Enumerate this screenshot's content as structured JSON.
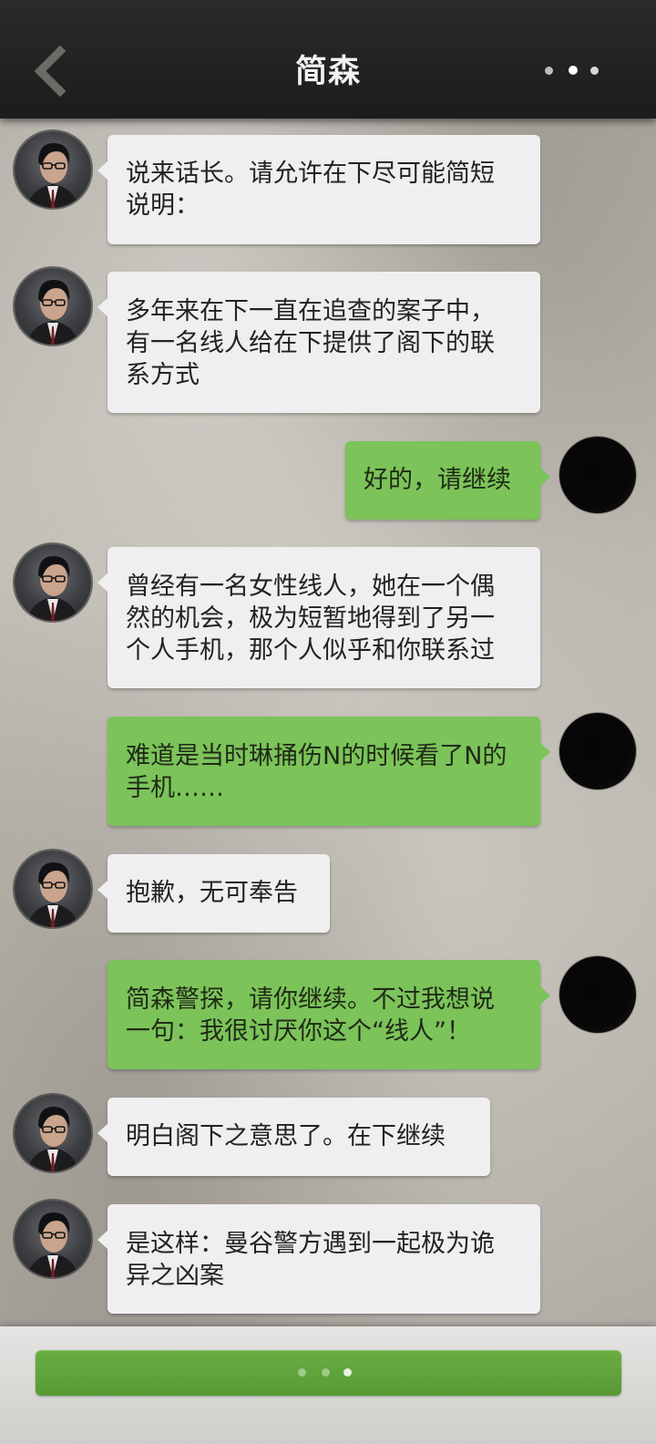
{
  "header": {
    "title": "简森",
    "back_icon": "chevron-left-icon",
    "more_icon": "more-dots-icon"
  },
  "colors": {
    "header_bg": "#242220",
    "incoming_bubble": "#efefef",
    "outgoing_bubble": "#7cc35a",
    "continue_button": "#5fa33b"
  },
  "messages": [
    {
      "sender": "jansen",
      "text": "说来话长。请允许在下尽可能简短\n说明："
    },
    {
      "sender": "jansen",
      "text": "多年来在下一直在追查的案子中，\n有一名线人给在下提供了阁下的联\n系方式"
    },
    {
      "sender": "me",
      "text": "好的，请继续"
    },
    {
      "sender": "jansen",
      "text": "曾经有一名女性线人，她在一个偶\n然的机会，极为短暂地得到了另一\n个人手机，那个人似乎和你联系过"
    },
    {
      "sender": "me",
      "text": "难道是当时琳捅伤N的时候看了N的\n手机……"
    },
    {
      "sender": "jansen",
      "text": "抱歉，无可奉告"
    },
    {
      "sender": "me",
      "text": "简森警探，请你继续。不过我想说\n一句：我很讨厌你这个“线人”！"
    },
    {
      "sender": "jansen",
      "text": "明白阁下之意思了。在下继续"
    },
    {
      "sender": "jansen",
      "text": "是这样：曼谷警方遇到一起极为诡\n异之凶案"
    }
  ],
  "footer": {
    "continue_icon": "ellipsis-icon"
  }
}
